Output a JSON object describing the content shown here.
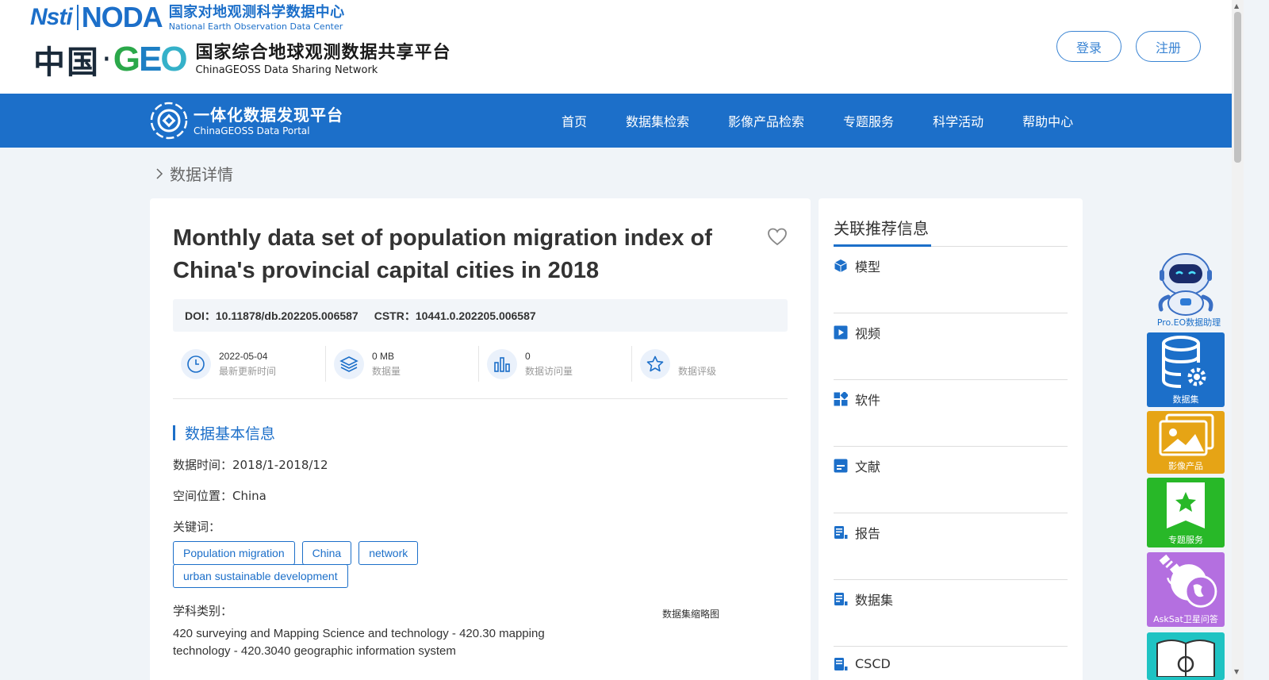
{
  "header": {
    "noda_short": "Nsti",
    "noda_word": "NODA",
    "noda_cn": "国家对地观测科学数据中心",
    "noda_en": "National Earth Observation Data Center",
    "china_cn": "中国",
    "geo_g": "G",
    "geo_e": "E",
    "geo_o": "O",
    "geoss_title": "国家综合地球观测数据共享平台",
    "geoss_en": "ChinaGEOSS Data Sharing Network",
    "login_label": "登录",
    "register_label": "注册"
  },
  "nav": {
    "portal_cn": "一体化数据发现平台",
    "portal_en": "ChinaGEOSS Data Portal",
    "items": [
      "首页",
      "数据集检索",
      "影像产品检索",
      "专题服务",
      "科学活动",
      "帮助中心"
    ]
  },
  "breadcrumb": {
    "current": "数据详情"
  },
  "dataset": {
    "title": "Monthly data set of population migration index of China's provincial capital cities in 2018",
    "doi_label": "DOI：",
    "doi": "10.11878/db.202205.006587",
    "cstr_label": "CSTR：",
    "cstr": "10441.0.202205.006587",
    "stats": [
      {
        "value": "2022-05-04",
        "label": "最新更新时间",
        "icon": "clock-icon"
      },
      {
        "value": "0 MB",
        "label": "数据量",
        "icon": "layers-icon"
      },
      {
        "value": "0",
        "label": "数据访问量",
        "icon": "bar-chart-icon"
      },
      {
        "value": "",
        "label": "数据评级",
        "icon": "star-icon"
      }
    ],
    "section_title": "数据基本信息",
    "time_label": "数据时间：",
    "time_value": "2018/1-2018/12",
    "space_label": "空间位置：",
    "space_value": "China",
    "keywords_label": "关键词：",
    "keywords": [
      "Population migration",
      "China",
      "network",
      "urban sustainable development"
    ],
    "subject_label": "学科类别：",
    "subject_value": "420 surveying and Mapping Science and technology - 420.30 mapping technology - 420.3040 geographic information system",
    "thumbnail_label": "数据集缩略图"
  },
  "sidebar": {
    "title": "关联推荐信息",
    "items": [
      {
        "label": "模型",
        "icon": "cube-icon"
      },
      {
        "label": "视频",
        "icon": "play-icon"
      },
      {
        "label": "软件",
        "icon": "apps-icon"
      },
      {
        "label": "文献",
        "icon": "document-icon"
      },
      {
        "label": "报告",
        "icon": "report-icon"
      },
      {
        "label": "数据集",
        "icon": "dataset-icon"
      },
      {
        "label": "CSCD",
        "icon": "cscd-icon"
      }
    ]
  },
  "float_toolbar": {
    "assistant": "Pro.EO数据助理",
    "dataset": "数据集",
    "image": "影像产品",
    "topic": "专题服务",
    "asksat": "AskSat卫星问答"
  },
  "colors": {
    "primary": "#1c6fc9",
    "image_btn": "#e6a415",
    "topic_btn": "#28b828",
    "asksat_btn": "#b46fe0",
    "book_btn": "#1fc3c3"
  }
}
